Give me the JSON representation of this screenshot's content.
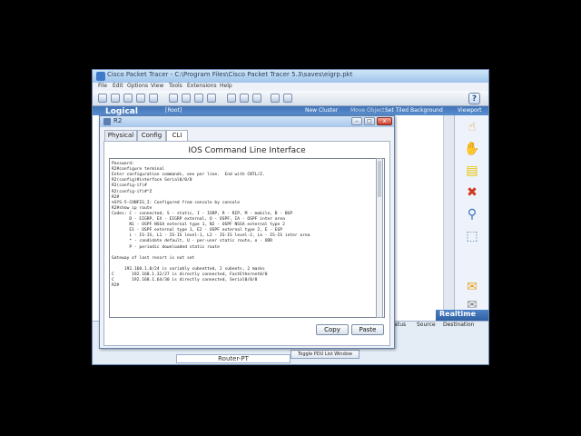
{
  "app": {
    "title": "Cisco Packet Tracer - C:\\Program Files\\Cisco Packet Tracer 5.3\\saves\\eigrp.pkt",
    "menu": [
      "File",
      "Edit",
      "Options",
      "View",
      "Tools",
      "Extensions",
      "Help"
    ],
    "help_glyph": "?"
  },
  "workspace_bar": {
    "logical": "Logical",
    "root": "[Root]",
    "new_cluster": "New Cluster",
    "move_object": "Move Object",
    "set_tiled_background": "Set Tiled Background",
    "viewport": "Viewport"
  },
  "bottom": {
    "realtime": "Realtime",
    "columns": [
      "Status",
      "Source",
      "Destination"
    ],
    "device_name": "Router-PT",
    "toggle_pdu": "Toggle PDU List Window"
  },
  "dialog": {
    "title": "R2",
    "minimize": "–",
    "maximize": "□",
    "close": "x",
    "tabs": [
      "Physical",
      "Config",
      "CLI"
    ],
    "active_tab": "CLI",
    "heading": "IOS Command Line Interface",
    "copy_label": "Copy",
    "paste_label": "Paste"
  },
  "terminal": {
    "lines": [
      "R2>enable",
      "Password:",
      "R2#configure terminal",
      "Enter configuration commands, one per line.  End with CNTL/Z.",
      "R2(config)#interface Serial0/0/0",
      "R2(config-if)#",
      "R2(config-if)#^Z",
      "R2#",
      "%SYS-5-CONFIG_I: Configured from console by console",
      "R2#show ip route",
      "Codes: C - connected, S - static, I - IGRP, R - RIP, M - mobile, B - BGP",
      "       D - EIGRP, EX - EIGRP external, O - OSPF, IA - OSPF inter area",
      "       N1 - OSPF NSSA external type 1, N2 - OSPF NSSA external type 2",
      "       E1 - OSPF external type 1, E2 - OSPF external type 2, E - EGP",
      "       i - IS-IS, L1 - IS-IS level-1, L2 - IS-IS level-2, ia - IS-IS inter area",
      "       * - candidate default, U - per-user static route, o - ODR",
      "       P - periodic downloaded static route",
      "",
      "Gateway of last resort is not set",
      "",
      "     192.168.1.0/24 is variably subnetted, 2 subnets, 2 masks",
      "C       192.168.1.32/27 is directly connected, FastEthernet0/0",
      "C       192.168.1.64/30 is directly connected, Serial0/0/0",
      "R2#"
    ]
  }
}
